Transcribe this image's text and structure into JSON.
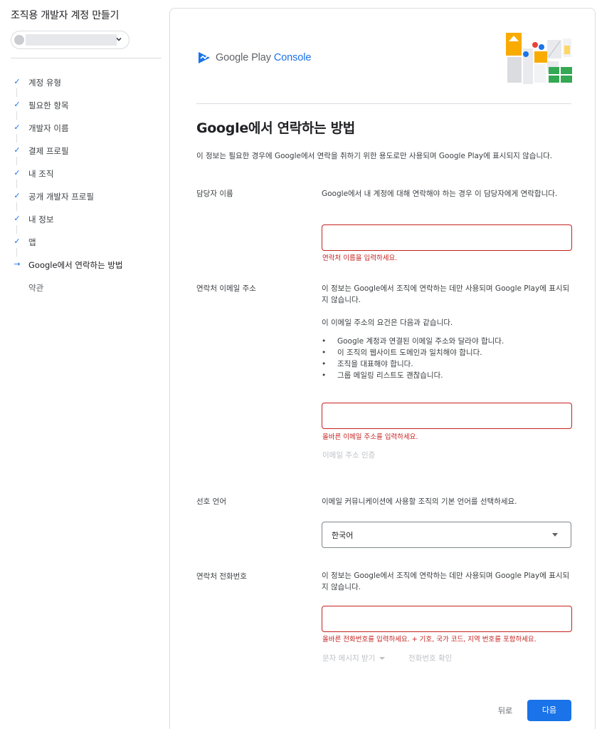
{
  "sidebar": {
    "title": "조직용 개발자 계정 만들기",
    "steps": [
      {
        "label": "계정 유형",
        "state": "done"
      },
      {
        "label": "필요한 항목",
        "state": "done"
      },
      {
        "label": "개발자 이름",
        "state": "done"
      },
      {
        "label": "결제 프로필",
        "state": "done"
      },
      {
        "label": "내 조직",
        "state": "done"
      },
      {
        "label": "공개 개발자 프로필",
        "state": "done"
      },
      {
        "label": "내 정보",
        "state": "done"
      },
      {
        "label": "앱",
        "state": "done"
      },
      {
        "label": "Google에서 연락하는 방법",
        "state": "current"
      },
      {
        "label": "약관",
        "state": "upcoming"
      }
    ]
  },
  "brand": {
    "logo_prefix": "Google Play",
    "logo_suffix": "Console"
  },
  "page": {
    "title": "Google에서 연락하는 방법",
    "intro": "이 정보는 필요한 경우에 Google에서 연락을 취하기 위한 용도로만 사용되며 Google Play에 표시되지 않습니다."
  },
  "contact_name": {
    "label": "담당자 이름",
    "description": "Google에서 내 계정에 대해 연락해야 하는 경우 이 담당자에게 연락합니다.",
    "value": "",
    "error": "연락처 이름을 입력하세요."
  },
  "contact_email": {
    "label": "연락처 이메일 주소",
    "description": "이 정보는 Google에서 조직에 연락하는 데만 사용되며 Google Play에 표시되지 않습니다.",
    "requirements_intro": "이 이메일 주소의 요건은 다음과 같습니다.",
    "requirements": [
      "Google 계정과 연결된 이메일 주소와 달라야 합니다.",
      "이 조직의 웹사이트 도메인과 일치해야 합니다.",
      "조직을 대표해야 합니다.",
      "그룹 메일링 리스트도 괜찮습니다."
    ],
    "value": "",
    "error": "올바른 이메일 주소를 입력하세요.",
    "verify_label": "이메일 주소 인증"
  },
  "language": {
    "label": "선호 언어",
    "description": "이메일 커뮤니케이션에 사용할 조직의 기본 언어를 선택하세요.",
    "selected": "한국어"
  },
  "contact_phone": {
    "label": "연락처 전화번호",
    "description": "이 정보는 Google에서 조직에 연락하는 데만 사용되며 Google Play에 표시되지 않습니다.",
    "value": "",
    "error": "올바른 전화번호를 입력하세요. + 기호, 국가 코드, 지역 번호를 포함하세요.",
    "sms_label": "문자 메시지 받기",
    "verify_label": "전화번호 확인"
  },
  "footer": {
    "back_label": "뒤로",
    "next_label": "다음"
  },
  "colors": {
    "accent": "#1a73e8",
    "error": "#c5221f",
    "disabled_text": "#bdc1c6",
    "border": "#dadce0"
  }
}
